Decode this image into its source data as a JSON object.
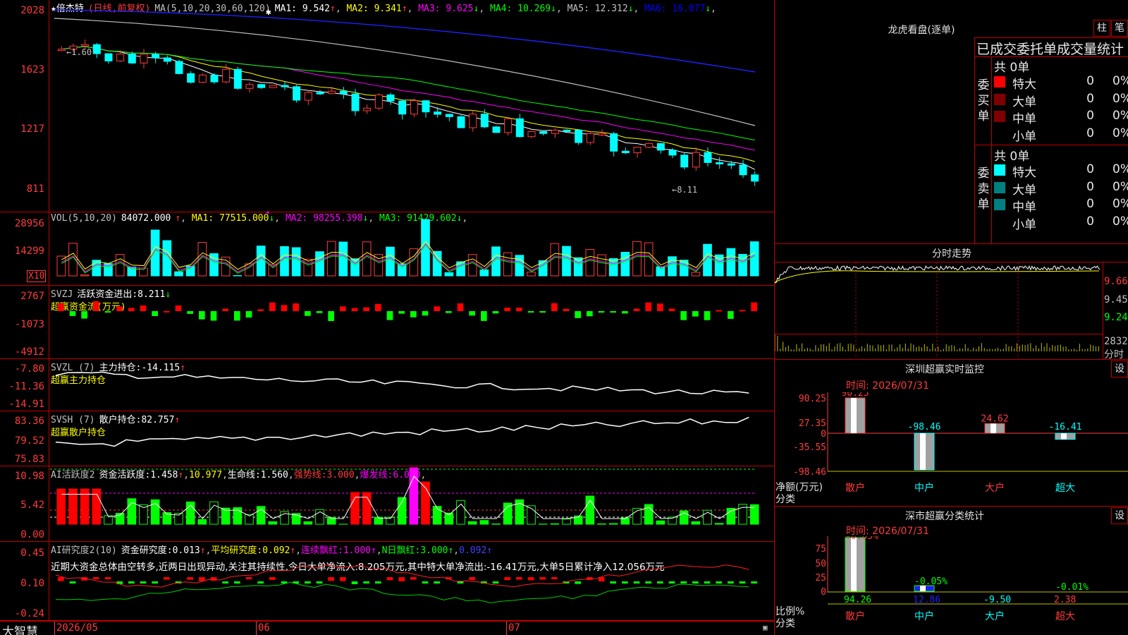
{
  "stock": {
    "star": "★",
    "name": "倍杰特",
    "period": "(日线,前复权)"
  },
  "ma_header": {
    "label": "MA(5,10,20,30,60,120)",
    "items": [
      {
        "name": "MA1",
        "value": "9.542",
        "arrow": "↑",
        "color": "#ffffff"
      },
      {
        "name": "MA2",
        "value": "9.341",
        "arrow": "↑",
        "color": "#ffff00"
      },
      {
        "name": "MA3",
        "value": "9.625",
        "arrow": "↓",
        "color": "#ff00ff"
      },
      {
        "name": "MA4",
        "value": "10.269",
        "arrow": "↓",
        "color": "#00ff00"
      },
      {
        "name": "MA5",
        "value": "12.312",
        "arrow": "↓",
        "color": "#c0c0c0"
      },
      {
        "name": "MA6",
        "value": "16.077",
        "arrow": "↓",
        "color": "#0000ff"
      }
    ]
  },
  "price_axis": [
    "2028",
    "1623",
    "1217",
    "811"
  ],
  "price_annotations": {
    "high": "←1.60",
    "low": "←8.11"
  },
  "vol_header": {
    "label": "VOL(5,10,20)",
    "value": "84072.000",
    "arrow": "↑",
    "items": [
      {
        "name": "MA1",
        "value": "77515.000",
        "arrow": "↓",
        "color": "#ffff00"
      },
      {
        "name": "MA2",
        "value": "98255.398",
        "arrow": "↓",
        "color": "#ff00ff"
      },
      {
        "name": "MA3",
        "value": "91429.602",
        "arrow": "↓",
        "color": "#00ff00"
      }
    ]
  },
  "vol_axis": [
    "28956",
    "14299"
  ],
  "vol_unit": "X10",
  "svzj_header": {
    "label": "SVZJ",
    "title": "活跃资金进出:",
    "value": "8.211",
    "arrow": "↓",
    "sub": "超赢资金流(万元)"
  },
  "svzj_axis": [
    "2767",
    "-1073",
    "-4912"
  ],
  "svzl_header": {
    "label": "SVZL (7)",
    "title": "主力持仓:",
    "value": "-14.115",
    "arrow": "↑",
    "sub": "超赢主力持仓"
  },
  "svzl_axis": [
    "-7.80",
    "-11.36",
    "-14.91"
  ],
  "svsh_header": {
    "label": "SVSH (7)",
    "title": "散户持仓:",
    "value": "82.757",
    "arrow": "↑",
    "sub": "超赢散户持仓"
  },
  "svsh_axis": [
    "83.36",
    "79.52",
    "75.83"
  ],
  "ai_active": {
    "label": "AI活跃度2",
    "title": "资金活跃度:",
    "value": "1.458",
    "arrow": "↑",
    "v2": "10.977",
    "life_label": "生命线:",
    "life": "1.560",
    "strong_label": "强势线:",
    "strong": "3.000",
    "burst_label": "爆发线:",
    "burst": "6.000"
  },
  "ai_active_axis": [
    "10.98",
    "5.42",
    "0.00"
  ],
  "ai_research": {
    "label": "AI研究度2(10)",
    "title": "资金研究度:",
    "value": "0.013",
    "arrow": "↑",
    "avg_label": "平均研究度:",
    "avg": "0.092",
    "avg_arrow": "↑",
    "red_label": "连续飘红:",
    "red": "1.000",
    "red_arrow": "↑",
    "n_label": "N日飘红:",
    "n": "3.000",
    "n_arrow": "↑",
    "last": "0.092",
    "last_arrow": "↑",
    "text": "近期大资金总体由空转多,近两日出现异动,关注其持续性,今日大单净流入:8.205万元,其中特大单净流出:-16.41万元,大单5日累计净入12.056万元"
  },
  "ai_research_axis": [
    "0.45",
    "0.10",
    "-0.24"
  ],
  "bottom_axis": {
    "brand": "大智慧",
    "dates": [
      "2026/05",
      "06",
      "07"
    ]
  },
  "right_top": {
    "title": "龙虎看盘(逐单)",
    "btn1": "柱",
    "btn2": "笔",
    "header": "已成交委托单成交量统计",
    "buy": {
      "total": "共 0单",
      "side": "委买单",
      "rows": [
        {
          "name": "特大",
          "count": "0",
          "pct": "0%",
          "color": "#ff0000"
        },
        {
          "name": "大单",
          "count": "0",
          "pct": "0%",
          "color": "#800000"
        },
        {
          "name": "中单",
          "count": "0",
          "pct": "0%",
          "color": "#800000"
        },
        {
          "name": "小单",
          "count": "0",
          "pct": "0%",
          "color": "#000000"
        }
      ]
    },
    "sell": {
      "total": "共 0单",
      "side": "委卖单",
      "rows": [
        {
          "name": "特大",
          "count": "0",
          "pct": "0%",
          "color": "#00ffff"
        },
        {
          "name": "大单",
          "count": "0",
          "pct": "0%",
          "color": "#008080"
        },
        {
          "name": "中单",
          "count": "0",
          "pct": "0%",
          "color": "#008080"
        },
        {
          "name": "小单",
          "count": "0",
          "pct": "0%",
          "color": "#000000"
        }
      ]
    }
  },
  "intraday": {
    "title": "分时走势",
    "axis": [
      "9.66",
      "9.45",
      "9.24"
    ],
    "vol_label": "2832",
    "vol_unit": "分时"
  },
  "sz_monitor": {
    "title": "深圳超赢实时监控",
    "btn": "设",
    "time": "时间: 2026/07/31",
    "axis": [
      "90.25",
      "27.35",
      "0",
      "-35.55",
      "-98.46"
    ],
    "y_unit": "净额(万元)",
    "x_unit": "分类",
    "cats": [
      "散户",
      "中户",
      "大户",
      "超大"
    ],
    "values": [
      90.25,
      -98.46,
      24.62,
      -16.41
    ],
    "labels": [
      "90.25",
      "-98.46",
      "24.62",
      "-16.41"
    ]
  },
  "sz_class": {
    "title": "深市超赢分类统计",
    "btn": "设",
    "time": "时间: 2026/07/31",
    "axis": [
      "75",
      "50",
      "25",
      "0"
    ],
    "y_unit": "比例%",
    "x_unit": "分类",
    "cats": [
      "散户",
      "中户",
      "大户",
      "超大"
    ],
    "values": [
      94.26,
      12.86,
      -9.5,
      2.38
    ],
    "labels": [
      "94.26",
      "12.86",
      "-9.50",
      "2.38"
    ],
    "pct_labels": [
      "+0.05%",
      "-0.05%",
      "",
      "-0.01%"
    ]
  }
}
